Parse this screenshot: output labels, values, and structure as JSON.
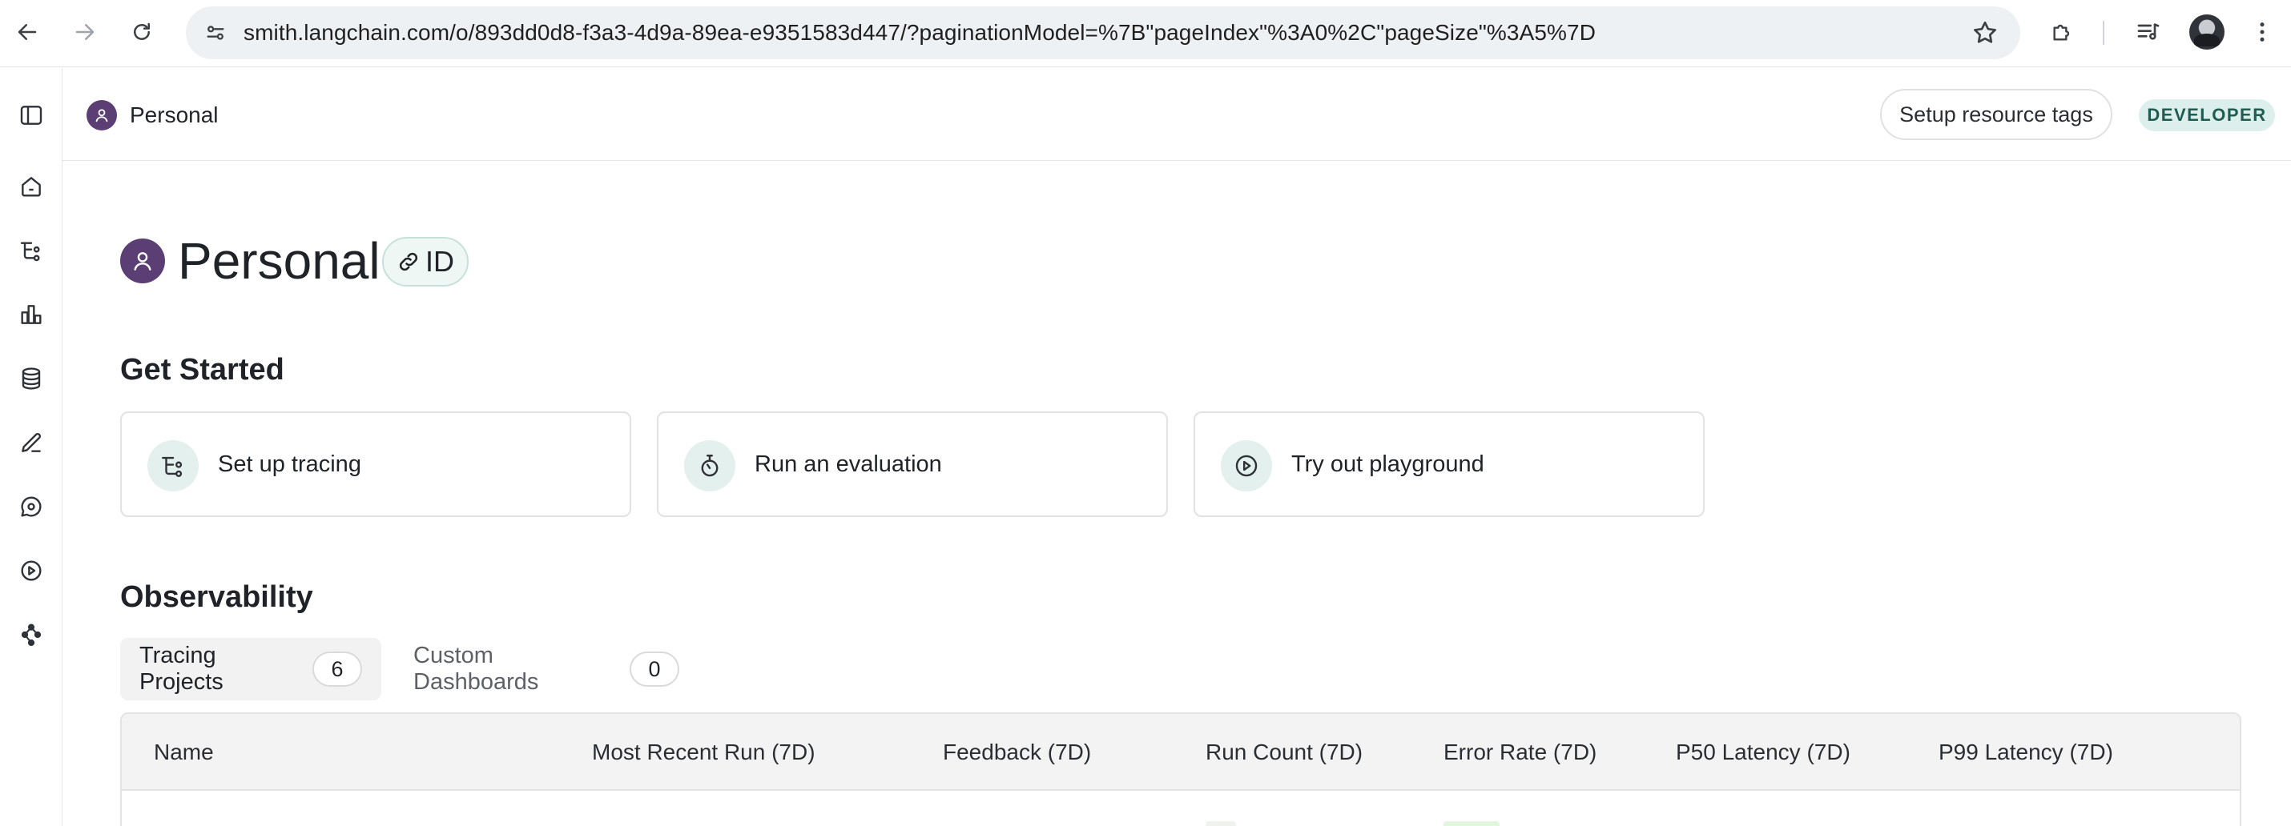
{
  "browser": {
    "url_host": "smith.langchain.com",
    "url_path": "/o/893dd0d8-f3a3-4d9a-89ea-e9351583d447/?paginationModel=%7B\"pageIndex\"%3A0%2C\"pageSize\"%3A5%7D"
  },
  "header": {
    "workspace_name": "Personal",
    "setup_tags_label": "Setup resource tags",
    "role_badge": "DEVELOPER"
  },
  "rail": {
    "items": [
      "sidebar-toggle",
      "home",
      "tracing",
      "monitoring",
      "datasets",
      "annotation",
      "prompts",
      "playground",
      "deployments"
    ]
  },
  "page": {
    "title": "Personal",
    "id_label": "ID"
  },
  "get_started": {
    "title": "Get Started",
    "cards": [
      {
        "label": "Set up tracing",
        "icon": "tracing-icon"
      },
      {
        "label": "Run an evaluation",
        "icon": "stopwatch-icon"
      },
      {
        "label": "Try out playground",
        "icon": "play-circle-icon"
      }
    ]
  },
  "observability": {
    "title": "Observability",
    "tabs": [
      {
        "label": "Tracing Projects",
        "count": "6"
      },
      {
        "label": "Custom Dashboards",
        "count": "0"
      }
    ],
    "columns": [
      "Name",
      "Most Recent Run (7D)",
      "Feedback (7D)",
      "Run Count (7D)",
      "Error Rate (7D)",
      "P50 Latency (7D)",
      "P99 Latency (7D)"
    ]
  },
  "colors": {
    "accent_teal": "#dcefec",
    "workspace_avatar": "#5b3f74"
  }
}
